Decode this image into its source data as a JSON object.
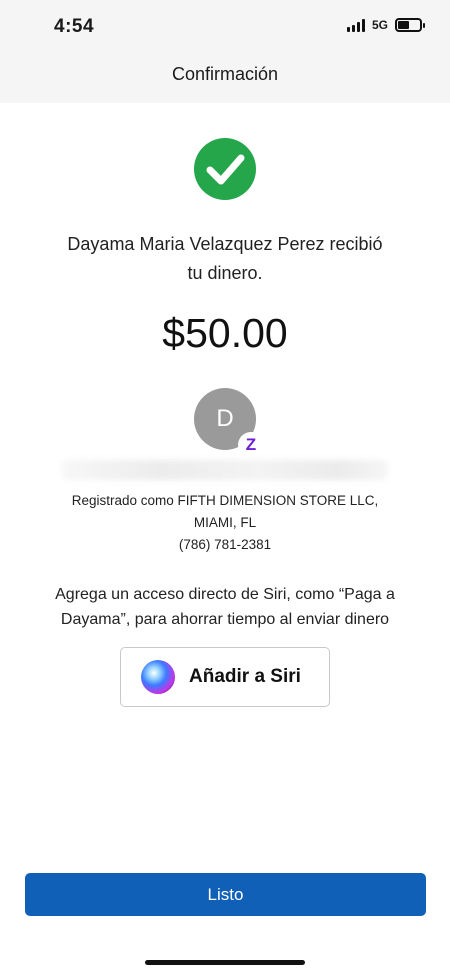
{
  "status_bar": {
    "time": "4:54",
    "network": "5G",
    "battery_level": 0.5
  },
  "header": {
    "title": "Confirmación"
  },
  "confirmation": {
    "icon": "checkmark-circle-icon",
    "icon_color": "#26a64b",
    "recipient_line1": "Dayama Maria Velazquez Perez recibió",
    "recipient_line2": "tu dinero.",
    "amount": "$50.00"
  },
  "recipient_card": {
    "avatar_initial": "D",
    "badge_icon": "zelle-icon",
    "badge_glyph": "Z",
    "badge_color": "#6d1ed4",
    "registered_line": "Registrado como FIFTH DIMENSION STORE LLC,",
    "city_line": "MIAMI, FL",
    "phone": "(786) 781-2381"
  },
  "siri": {
    "text_line1": "Agrega un acceso directo de Siri, como “Paga a",
    "text_line2": "Dayama”, para ahorrar tiempo al enviar dinero",
    "button_label": "Añadir a Siri",
    "button_icon": "siri-icon"
  },
  "footer": {
    "done_label": "Listo",
    "done_color": "#1160b8"
  }
}
